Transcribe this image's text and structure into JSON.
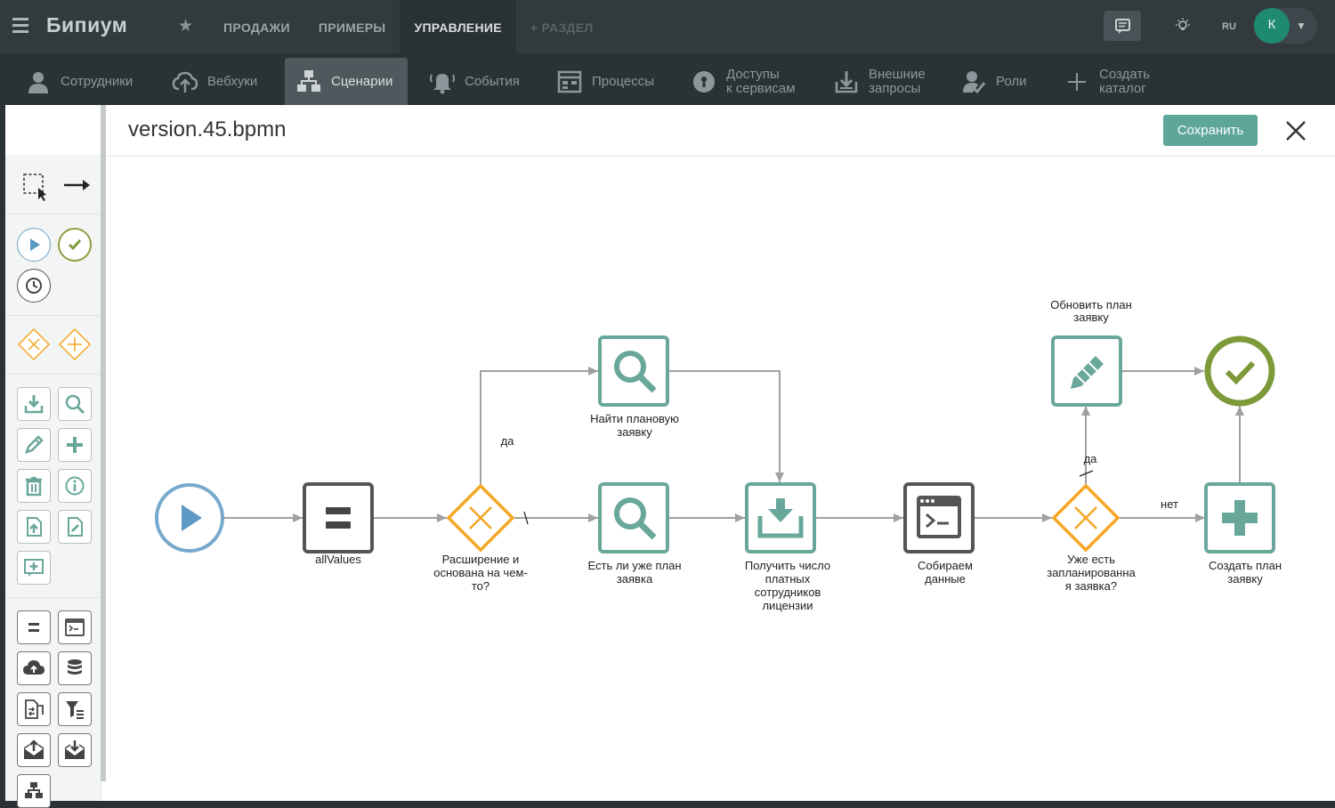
{
  "app": {
    "logo": "Бипиум"
  },
  "topnav": {
    "items": [
      {
        "label": "ПРОДАЖИ"
      },
      {
        "label": "ПРИМЕРЫ"
      },
      {
        "label": "УПРАВЛЕНИЕ"
      },
      {
        "label": "+ РАЗДЕЛ"
      }
    ]
  },
  "user": {
    "lang": "RU",
    "avatar_letter": "К"
  },
  "subnav": {
    "items": [
      {
        "label": "Сотрудники"
      },
      {
        "label": "Вебхуки"
      },
      {
        "label": "Сценарии"
      },
      {
        "label": "События"
      },
      {
        "label": "Процессы"
      },
      {
        "label1": "Доступы",
        "label2": "к сервисам"
      },
      {
        "label1": "Внешние",
        "label2": "запросы"
      },
      {
        "label": "Роли"
      },
      {
        "label1": "Создать",
        "label2": "каталог"
      }
    ]
  },
  "editor": {
    "file_name": "version.45.bpmn",
    "save_label": "Сохранить"
  },
  "diagram": {
    "nodes": {
      "all_values": "allValues",
      "gateway1": [
        "Расширение и",
        "основана на чем-",
        "то?"
      ],
      "find_plan": [
        "Найти плановую",
        "заявку"
      ],
      "is_plan": [
        "Есть ли уже план",
        "заявка"
      ],
      "get_count": [
        "Получить число",
        "платных",
        "сотрудников",
        "лицензии"
      ],
      "collect": [
        "Собираем",
        "данные"
      ],
      "gateway2": [
        "Уже есть",
        "запланированна",
        "я заявка?"
      ],
      "update_plan": [
        "Обновить план",
        "заявку"
      ],
      "create_plan": [
        "Создать план",
        "заявку"
      ]
    },
    "flows": {
      "yes1": "да",
      "yes2": "да",
      "no": "нет"
    }
  }
}
